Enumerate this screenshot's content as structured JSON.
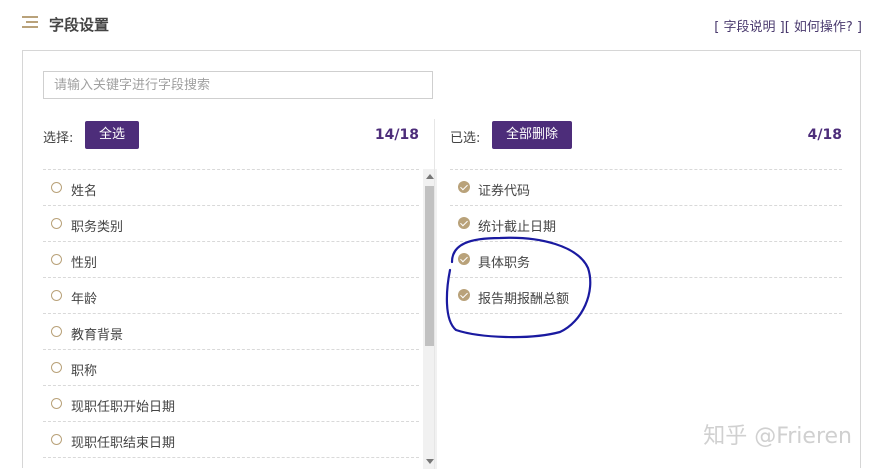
{
  "header": {
    "title": "字段设置",
    "help_text": "[ 字段说明 ][ 如何操作? ]"
  },
  "search": {
    "placeholder": "请输入关键字进行字段搜索"
  },
  "left": {
    "select_label": "选择:",
    "select_all_button": "全选",
    "count": "14/18",
    "items": [
      {
        "label": "姓名"
      },
      {
        "label": "职务类别"
      },
      {
        "label": "性别"
      },
      {
        "label": "年龄"
      },
      {
        "label": "教育背景"
      },
      {
        "label": "职称"
      },
      {
        "label": "现职任职开始日期"
      },
      {
        "label": "现职任职结束日期"
      }
    ]
  },
  "right": {
    "selected_label": "已选:",
    "delete_all_button": "全部删除",
    "count": "4/18",
    "items": [
      {
        "label": "证券代码"
      },
      {
        "label": "统计截止日期"
      },
      {
        "label": "具体职务"
      },
      {
        "label": "报告期报酬总额"
      }
    ]
  },
  "watermark": "知乎 @Frieren",
  "colors": {
    "accent": "#4d2d7a",
    "gold": "#b9a27a",
    "annotation": "#1a1aa0"
  }
}
